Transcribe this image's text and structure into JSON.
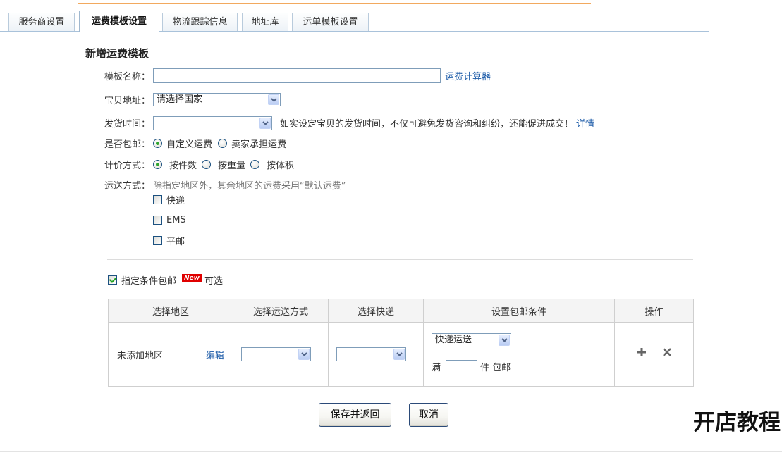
{
  "theme": {
    "accent": "#f2a95f",
    "link": "#1c5ba8",
    "badge": "#e00000"
  },
  "tabs": [
    {
      "label": "服务商设置",
      "active": false
    },
    {
      "label": "运费模板设置",
      "active": true
    },
    {
      "label": "物流跟踪信息",
      "active": false
    },
    {
      "label": "地址库",
      "active": false
    },
    {
      "label": "运单模板设置",
      "active": false
    }
  ],
  "form": {
    "title": "新增运费模板",
    "template_name": {
      "label": "模板名称：",
      "value": "",
      "calculator_link": "运费计算器"
    },
    "item_location": {
      "label": "宝贝地址：",
      "selected": "请选择国家"
    },
    "ship_time": {
      "label": "发货时间：",
      "selected": "",
      "hint": "如实设定宝贝的发货时间，不仅可避免发货咨询和纠纷，还能促进成交！",
      "details_link": "详情"
    },
    "free_shipping": {
      "label": "是否包邮：",
      "options": [
        {
          "label": "自定义运费",
          "checked": true
        },
        {
          "label": "卖家承担运费",
          "checked": false
        }
      ]
    },
    "pricing_method": {
      "label": "计价方式：",
      "options": [
        {
          "label": "按件数",
          "checked": true
        },
        {
          "label": "按重量",
          "checked": false
        },
        {
          "label": "按体积",
          "checked": false
        }
      ]
    },
    "delivery_method": {
      "label": "运送方式：",
      "hint": "除指定地区外，其余地区的运费采用“默认运费”",
      "options": [
        {
          "label": "快递",
          "checked": false
        },
        {
          "label": "EMS",
          "checked": false
        },
        {
          "label": "平邮",
          "checked": false
        }
      ]
    }
  },
  "conditional_free_shipping": {
    "label": "指定条件包邮",
    "checked": true,
    "badge": "New",
    "note": "可选"
  },
  "table": {
    "headers": [
      "选择地区",
      "选择运送方式",
      "选择快递",
      "设置包邮条件",
      "操作"
    ],
    "rows": [
      {
        "region": "未添加地区",
        "edit_link": "编辑",
        "delivery_method": "",
        "courier": "",
        "condition_type": "快递运送",
        "condition_prefix": "满",
        "quantity": "",
        "condition_suffix": "件 包邮",
        "actions": [
          {
            "icon": "plus-icon"
          },
          {
            "icon": "close-icon"
          }
        ]
      }
    ]
  },
  "buttons": {
    "save": "保存并返回",
    "cancel": "取消"
  },
  "watermark": "开店教程"
}
